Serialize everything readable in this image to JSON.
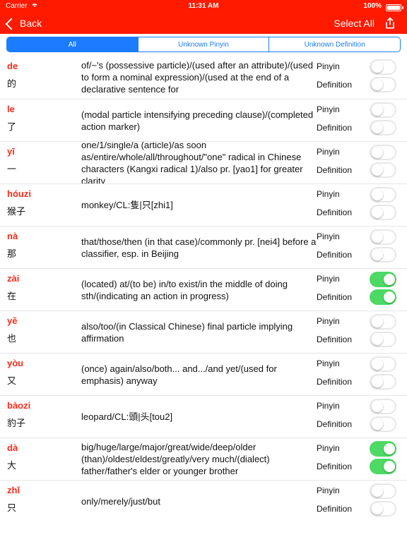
{
  "status": {
    "carrier": "Carrier",
    "time": "11:31 AM",
    "battery_text": "100%",
    "battery_level": 1.0
  },
  "nav": {
    "back_label": "Back",
    "select_all_label": "Select All",
    "icons": {
      "back": "chevron-left-icon",
      "share": "share-icon",
      "wifi": "wifi-icon",
      "battery": "battery-icon"
    }
  },
  "tabs": [
    {
      "label": "All",
      "active": true
    },
    {
      "label": "Unknown Pinyin",
      "active": false
    },
    {
      "label": "Unknown Definition",
      "active": false
    }
  ],
  "row_labels": {
    "pinyin": "Pinyin",
    "definition": "Definition"
  },
  "colors": {
    "brand_red": "#ff1a00",
    "accent_blue": "#1b7cff",
    "toggle_on": "#4cd964",
    "pinyin_red": "#ff2a18"
  },
  "rows": [
    {
      "pinyin": "de",
      "hanzi": "的",
      "definition": "of/~'s (possessive particle)/(used after an attribute)/(used to form a nominal expression)/(used at the end of a declarative sentence for",
      "pinyin_on": false,
      "definition_on": false
    },
    {
      "pinyin": "le",
      "hanzi": "了",
      "definition": "(modal particle intensifying preceding clause)/(completed action marker)",
      "pinyin_on": false,
      "definition_on": false
    },
    {
      "pinyin": "yī",
      "hanzi": "一",
      "definition": "one/1/single/a (article)/as soon as/entire/whole/all/throughout/\"one\" radical in Chinese characters (Kangxi radical 1)/also pr. [yao1] for greater clarity",
      "pinyin_on": false,
      "definition_on": false
    },
    {
      "pinyin": "hóuzi",
      "hanzi": "猴子",
      "definition": "monkey/CL:隻|只[zhi1]",
      "pinyin_on": false,
      "definition_on": false
    },
    {
      "pinyin": "nà",
      "hanzi": "那",
      "definition": "that/those/then (in that case)/commonly pr. [nei4] before a classifier, esp. in Beijing",
      "pinyin_on": false,
      "definition_on": false
    },
    {
      "pinyin": "zài",
      "hanzi": "在",
      "definition": "(located) at/(to be) in/to exist/in the middle of doing sth/(indicating an action in progress)",
      "pinyin_on": true,
      "definition_on": true
    },
    {
      "pinyin": "yě",
      "hanzi": "也",
      "definition": "also/too/(in Classical Chinese) final particle implying affirmation",
      "pinyin_on": false,
      "definition_on": false
    },
    {
      "pinyin": "yòu",
      "hanzi": "又",
      "definition": "(once) again/also/both... and.../and yet/(used for emphasis) anyway",
      "pinyin_on": false,
      "definition_on": false
    },
    {
      "pinyin": "bàozi",
      "hanzi": "豹子",
      "definition": "leopard/CL:頭|头[tou2]",
      "pinyin_on": false,
      "definition_on": false
    },
    {
      "pinyin": "dà",
      "hanzi": "大",
      "definition": "big/huge/large/major/great/wide/deep/older (than)/oldest/eldest/greatly/very much/(dialect) father/father's elder or younger brother",
      "pinyin_on": true,
      "definition_on": true
    },
    {
      "pinyin": "zhǐ",
      "hanzi": "只",
      "definition": "only/merely/just/but",
      "pinyin_on": false,
      "definition_on": false
    }
  ]
}
